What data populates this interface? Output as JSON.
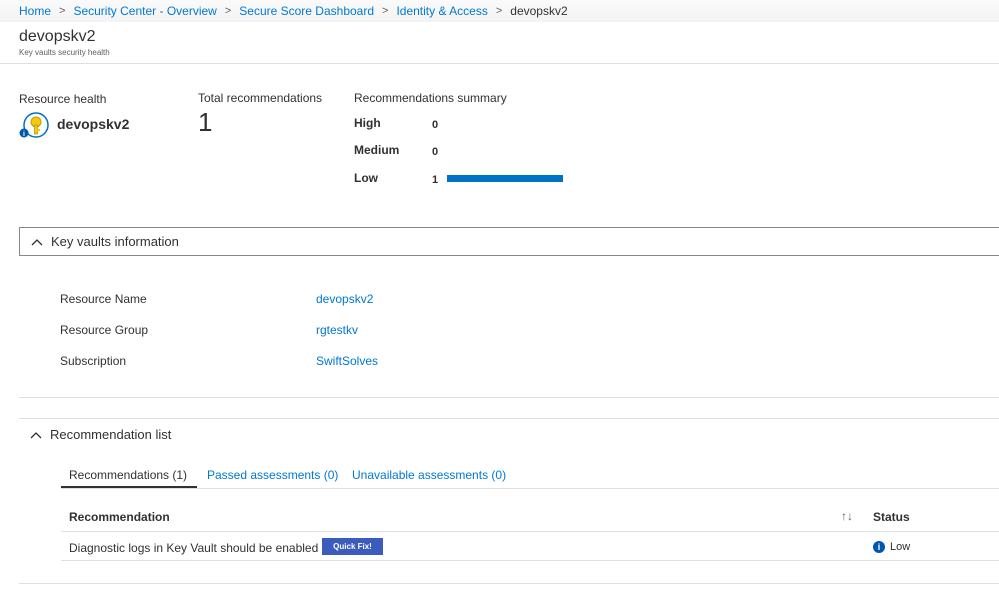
{
  "breadcrumb": {
    "items": [
      "Home",
      "Security Center - Overview",
      "Secure Score Dashboard",
      "Identity & Access"
    ],
    "current": "devopskv2"
  },
  "page": {
    "title": "devopskv2",
    "subtitle": "Key vaults security health"
  },
  "summary": {
    "resource_health_label": "Resource health",
    "resource_name": "devopskv2",
    "total_label": "Total recommendations",
    "total_value": "1",
    "recs_summary_label": "Recommendations summary",
    "severities": [
      {
        "label": "High",
        "count": "0"
      },
      {
        "label": "Medium",
        "count": "0"
      },
      {
        "label": "Low",
        "count": "1"
      }
    ],
    "bar_color": "#0072c6"
  },
  "kv_info": {
    "title": "Key vaults information",
    "rows": [
      {
        "label": "Resource Name",
        "value": "devopskv2"
      },
      {
        "label": "Resource Group",
        "value": "rgtestkv"
      },
      {
        "label": "Subscription",
        "value": "SwiftSolves"
      }
    ]
  },
  "rec_list": {
    "title": "Recommendation list",
    "tabs": [
      "Recommendations (1)",
      "Passed assessments (0)",
      "Unavailable assessments (0)"
    ],
    "columns": {
      "recommendation": "Recommendation",
      "status": "Status"
    },
    "rows": [
      {
        "recommendation": "Diagnostic logs in Key Vault should be enabled",
        "action": "Quick Fix!",
        "status": "Low"
      }
    ]
  },
  "icons": {
    "breadcrumb_sep": "chevron-right-icon",
    "resource": "key-vault-icon",
    "section_toggle": "chevron-up-icon",
    "sort": "sort-icon",
    "status": "info-icon"
  },
  "colors": {
    "link": "#0078d4",
    "accent": "#0072c6",
    "button": "#3b5bbd"
  }
}
